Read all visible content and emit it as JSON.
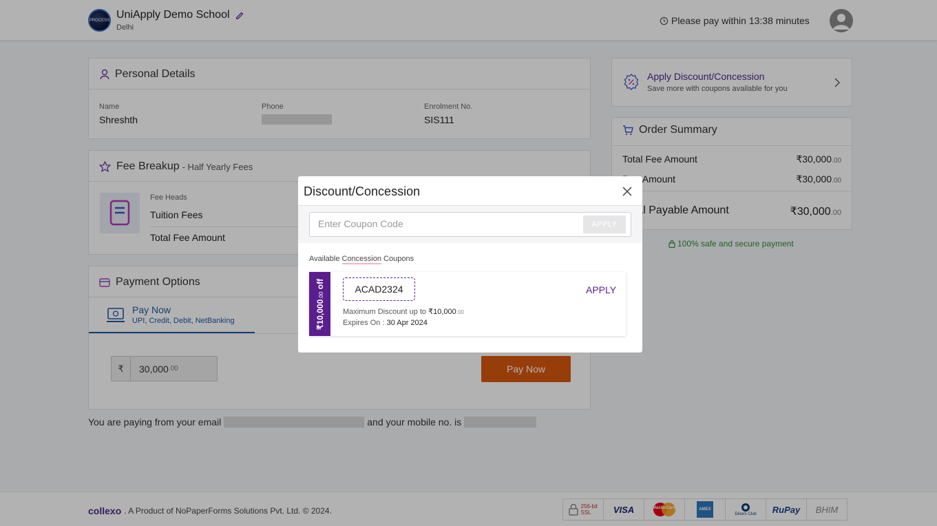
{
  "header": {
    "logo_text": "PROCESS",
    "school_name": "UniApply Demo School",
    "city": "Delhi",
    "timer_text": "Please pay within 13:38 minutes"
  },
  "personal": {
    "title": "Personal Details",
    "name_label": "Name",
    "name_value": "Shreshth",
    "phone_label": "Phone",
    "enrol_label": "Enrolment No.",
    "enrol_value": "SIS111"
  },
  "fee": {
    "title": "Fee Breakup",
    "subtitle": "- Half Yearly Fees",
    "heads_label": "Fee Heads",
    "row1": "Tuition Fees",
    "row2": "Total Fee Amount"
  },
  "payment": {
    "title": "Payment Options",
    "tab_title": "Pay Now",
    "tab_sub": "UPI, Credit, Debit, NetBanking",
    "currency": "₹",
    "amount_main": "30,000",
    "amount_dec": ".00",
    "pay_button": "Pay Now",
    "note_pre": "You are paying from your email",
    "note_mid": "and your mobile no. is"
  },
  "discount_card": {
    "title": "Apply Discount/Concession",
    "subtitle": "Save more with coupons available for you"
  },
  "order": {
    "title": "Order Summary",
    "row1_label": "Total Fee Amount",
    "row1_value": "₹30,000",
    "row1_dec": ".00",
    "row2_label": "Due Amount",
    "row2_value": "₹30,000",
    "row2_dec": ".00",
    "row3_label": "Total Payable Amount",
    "row3_value": "₹30,000",
    "row3_dec": ".00",
    "secure": "100% safe and secure payment"
  },
  "modal": {
    "title": "Discount/Concession",
    "coupon_placeholder": "Enter Coupon Code",
    "apply_btn": "APPLY",
    "available_pre": "Available ",
    "available_hl": "Concession",
    "available_post": " Coupons",
    "coupon": {
      "tag_main": "₹10,000",
      "tag_dec": ".00",
      "tag_off": " off",
      "code": "ACAD2324",
      "apply": "APPLY",
      "max_label": "Maximum Discount up to ",
      "max_value": "₹10,000",
      "max_dec": ".00",
      "exp_label": "Expires On : ",
      "exp_value": "30 Apr 2024"
    }
  },
  "footer": {
    "brand": "collexo",
    "text": ". A Product of NoPaperForms Solutions Pvt. Ltd. © 2024.",
    "ssl_text": "256-bit SSL",
    "logos": [
      "VISA",
      "MasterCard",
      "AMEX",
      "Diners Club",
      "RuPay",
      "BHIM"
    ]
  },
  "colors": {
    "accent": "#5b1e8e",
    "pay_button": "#d9580f",
    "link_blue": "#2456a8",
    "secure_green": "#2e8b3d"
  }
}
